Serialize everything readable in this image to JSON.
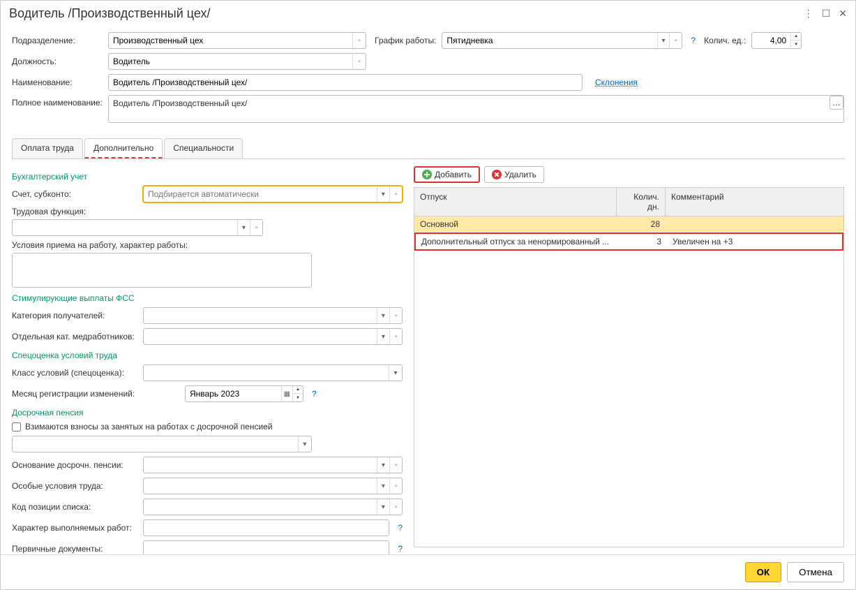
{
  "title": "Водитель /Производственный цех/",
  "header_fields": {
    "department_label": "Подразделение:",
    "department_value": "Производственный цех",
    "schedule_label": "График работы:",
    "schedule_value": "Пятидневка",
    "qty_label": "Колич. ед.:",
    "qty_value": "4,00",
    "position_label": "Должность:",
    "position_value": "Водитель",
    "name_label": "Наименование:",
    "name_value": "Водитель /Производственный цех/",
    "declension_link": "Склонения",
    "fullname_label": "Полное наименование:",
    "fullname_value": "Водитель /Производственный цех/"
  },
  "tabs": {
    "pay": "Оплата труда",
    "extra": "Дополнительно",
    "spec": "Специальности"
  },
  "left": {
    "accounting_title": "Бухгалтерский учет",
    "account_label": "Счет, субконто:",
    "account_placeholder": "Подбирается автоматически",
    "labor_func_label": "Трудовая функция:",
    "conditions_label": "Условия приема на работу, характер работы:",
    "fss_title": "Стимулирующие выплаты ФСС",
    "recipient_cat_label": "Категория получателей:",
    "med_cat_label": "Отдельная кат. медработников:",
    "sout_title": "Спецоценка условий труда",
    "class_label": "Класс условий (спецоценка):",
    "month_label": "Месяц регистрации изменений:",
    "month_value": "Январь 2023",
    "pension_title": "Досрочная пенсия",
    "pension_checkbox": "Взимаются взносы за занятых на работах с досрочной пенсией",
    "pension_basis_label": "Основание досрочн. пенсии:",
    "special_cond_label": "Особые условия труда:",
    "list_code_label": "Код позиции списка:",
    "work_nature_label": "Характер выполняемых работ:",
    "primary_docs_label": "Первичные документы:"
  },
  "right": {
    "add_btn": "Добавить",
    "del_btn": "Удалить",
    "col_otpusk": "Отпуск",
    "col_days": "Колич. дн.",
    "col_comment": "Комментарий",
    "rows": [
      {
        "otpusk": "Основной",
        "days": "28",
        "comment": ""
      },
      {
        "otpusk": "Дополнительный отпуск за ненормированный ...",
        "days": "3",
        "comment": "Увеличен на +3"
      }
    ]
  },
  "footer": {
    "ok": "ОК",
    "cancel": "Отмена"
  }
}
